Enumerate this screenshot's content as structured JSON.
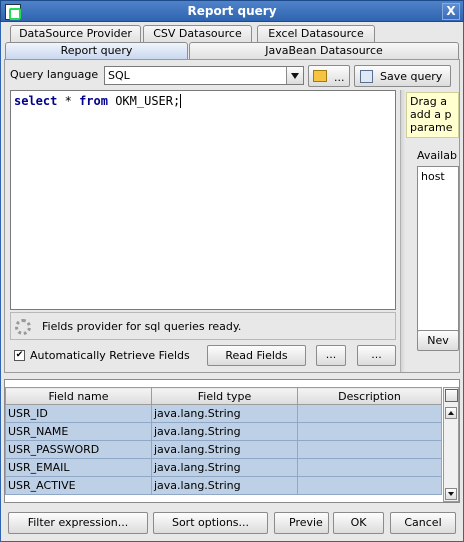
{
  "window": {
    "title": "Report query",
    "close_glyph": "X"
  },
  "tabs_row1": [
    {
      "label": "DataSource Provider"
    },
    {
      "label": "CSV Datasource"
    },
    {
      "label": "Excel Datasource"
    }
  ],
  "tabs_row2": [
    {
      "label": "Report query",
      "active": true
    },
    {
      "label": "JavaBean Datasource",
      "active": false
    }
  ],
  "query": {
    "language_label": "Query language",
    "language_value": "SQL",
    "open_button_label": "...",
    "save_button_label": "Save query",
    "sql_kw1": "select",
    "sql_star": "*",
    "sql_kw2": "from",
    "sql_table": "OKM_USER;"
  },
  "status": {
    "text": "Fields provider for sql queries ready."
  },
  "options": {
    "auto_retrieve_label": "Automatically Retrieve Fields",
    "auto_retrieve_checked": true,
    "read_fields_label": "Read Fields",
    "more1_label": "...",
    "more2_label": "..."
  },
  "side_panel": {
    "tip_lines": [
      "Drag a",
      "add a p",
      "parame"
    ],
    "available_label": "Availab",
    "list_items": [
      "host"
    ],
    "new_button_label": "Nev"
  },
  "fields_table": {
    "columns": [
      "Field name",
      "Field type",
      "Description"
    ],
    "rows": [
      {
        "name": "USR_ID",
        "type": "java.lang.String",
        "description": ""
      },
      {
        "name": "USR_NAME",
        "type": "java.lang.String",
        "description": ""
      },
      {
        "name": "USR_PASSWORD",
        "type": "java.lang.String",
        "description": ""
      },
      {
        "name": "USR_EMAIL",
        "type": "java.lang.String",
        "description": ""
      },
      {
        "name": "USR_ACTIVE",
        "type": "java.lang.String",
        "description": ""
      }
    ]
  },
  "footer": {
    "filter_label": "Filter expression...",
    "sort_label": "Sort options...",
    "preview_label": "Previe",
    "ok_label": "OK",
    "cancel_label": "Cancel"
  },
  "colors": {
    "title_bar": "#2f64b0",
    "selection": "#bed0e6",
    "keyword": "#00008b",
    "tip_background": "#ffffd0"
  }
}
